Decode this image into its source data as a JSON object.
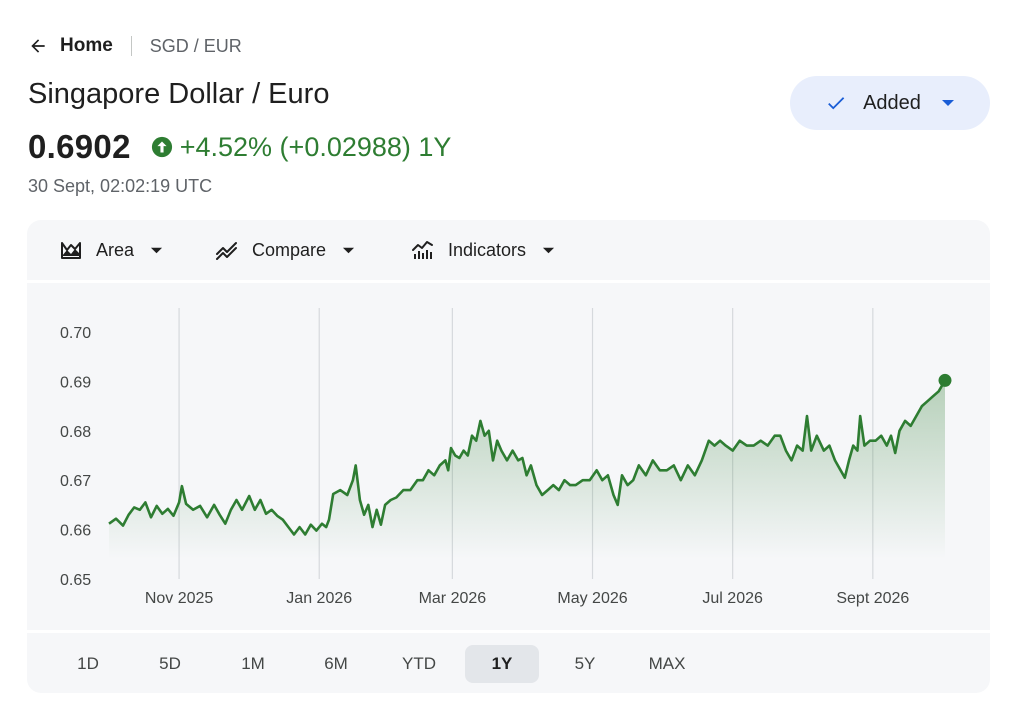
{
  "breadcrumb": {
    "home": "Home",
    "pair": "SGD / EUR"
  },
  "title": "Singapore Dollar / Euro",
  "quote": {
    "price": "0.6902",
    "change": "+4.52% (+0.02988) 1Y",
    "timestamp": "30 Sept, 02:02:19 UTC"
  },
  "watchlist_button": {
    "label": "Added"
  },
  "toolbar": {
    "area": "Area",
    "compare": "Compare",
    "indicators": "Indicators"
  },
  "ranges": [
    {
      "label": "1D",
      "active": false
    },
    {
      "label": "5D",
      "active": false
    },
    {
      "label": "1M",
      "active": false
    },
    {
      "label": "6M",
      "active": false
    },
    {
      "label": "YTD",
      "active": false
    },
    {
      "label": "1Y",
      "active": true
    },
    {
      "label": "5Y",
      "active": false
    },
    {
      "label": "MAX",
      "active": false
    }
  ],
  "colors": {
    "accent": "#2e7d32",
    "button_bg": "#e8eefc",
    "blue": "#1a5dd6"
  },
  "chart_data": {
    "type": "area",
    "ylim": [
      0.65,
      0.7
    ],
    "yticks": [
      "0.70",
      "0.69",
      "0.68",
      "0.67",
      "0.66",
      "0.65"
    ],
    "xticks": [
      {
        "label": "Nov 2025",
        "x": 1.0
      },
      {
        "label": "Jan 2026",
        "x": 3.0
      },
      {
        "label": "Mar 2026",
        "x": 4.9
      },
      {
        "label": "May 2026",
        "x": 6.9
      },
      {
        "label": "Jul 2026",
        "x": 8.9
      },
      {
        "label": "Sept 2026",
        "x": 10.9
      }
    ],
    "x_range": [
      0,
      11.93
    ],
    "series": [
      {
        "points": [
          [
            0.0,
            0.6612
          ],
          [
            0.1,
            0.6622
          ],
          [
            0.2,
            0.6608
          ],
          [
            0.28,
            0.663
          ],
          [
            0.36,
            0.6645
          ],
          [
            0.44,
            0.664
          ],
          [
            0.52,
            0.6655
          ],
          [
            0.6,
            0.6625
          ],
          [
            0.68,
            0.6648
          ],
          [
            0.76,
            0.6632
          ],
          [
            0.84,
            0.6642
          ],
          [
            0.92,
            0.6628
          ],
          [
            1.0,
            0.6655
          ],
          [
            1.04,
            0.6688
          ],
          [
            1.1,
            0.6652
          ],
          [
            1.2,
            0.664
          ],
          [
            1.3,
            0.6648
          ],
          [
            1.4,
            0.6625
          ],
          [
            1.5,
            0.665
          ],
          [
            1.58,
            0.663
          ],
          [
            1.66,
            0.6612
          ],
          [
            1.74,
            0.664
          ],
          [
            1.82,
            0.666
          ],
          [
            1.9,
            0.664
          ],
          [
            2.0,
            0.6668
          ],
          [
            2.08,
            0.664
          ],
          [
            2.16,
            0.666
          ],
          [
            2.24,
            0.6632
          ],
          [
            2.32,
            0.664
          ],
          [
            2.4,
            0.6628
          ],
          [
            2.48,
            0.662
          ],
          [
            2.56,
            0.6605
          ],
          [
            2.64,
            0.659
          ],
          [
            2.72,
            0.6605
          ],
          [
            2.8,
            0.659
          ],
          [
            2.88,
            0.661
          ],
          [
            2.96,
            0.6598
          ],
          [
            3.04,
            0.6612
          ],
          [
            3.1,
            0.6605
          ],
          [
            3.14,
            0.662
          ],
          [
            3.2,
            0.6672
          ],
          [
            3.3,
            0.668
          ],
          [
            3.4,
            0.667
          ],
          [
            3.48,
            0.67
          ],
          [
            3.52,
            0.673
          ],
          [
            3.58,
            0.666
          ],
          [
            3.64,
            0.663
          ],
          [
            3.7,
            0.665
          ],
          [
            3.76,
            0.6605
          ],
          [
            3.82,
            0.664
          ],
          [
            3.88,
            0.661
          ],
          [
            3.94,
            0.665
          ],
          [
            4.02,
            0.666
          ],
          [
            4.1,
            0.6665
          ],
          [
            4.2,
            0.668
          ],
          [
            4.3,
            0.668
          ],
          [
            4.4,
            0.67
          ],
          [
            4.48,
            0.67
          ],
          [
            4.56,
            0.672
          ],
          [
            4.64,
            0.671
          ],
          [
            4.72,
            0.673
          ],
          [
            4.8,
            0.674
          ],
          [
            4.84,
            0.672
          ],
          [
            4.88,
            0.6765
          ],
          [
            4.94,
            0.675
          ],
          [
            5.0,
            0.6745
          ],
          [
            5.06,
            0.676
          ],
          [
            5.12,
            0.675
          ],
          [
            5.18,
            0.679
          ],
          [
            5.24,
            0.678
          ],
          [
            5.3,
            0.682
          ],
          [
            5.36,
            0.679
          ],
          [
            5.42,
            0.68
          ],
          [
            5.48,
            0.674
          ],
          [
            5.54,
            0.678
          ],
          [
            5.6,
            0.676
          ],
          [
            5.68,
            0.674
          ],
          [
            5.76,
            0.676
          ],
          [
            5.84,
            0.674
          ],
          [
            5.9,
            0.6745
          ],
          [
            5.96,
            0.671
          ],
          [
            6.02,
            0.673
          ],
          [
            6.1,
            0.669
          ],
          [
            6.18,
            0.667
          ],
          [
            6.26,
            0.668
          ],
          [
            6.34,
            0.669
          ],
          [
            6.42,
            0.668
          ],
          [
            6.5,
            0.67
          ],
          [
            6.58,
            0.669
          ],
          [
            6.66,
            0.669
          ],
          [
            6.76,
            0.67
          ],
          [
            6.86,
            0.67
          ],
          [
            6.96,
            0.672
          ],
          [
            7.04,
            0.67
          ],
          [
            7.12,
            0.671
          ],
          [
            7.2,
            0.667
          ],
          [
            7.26,
            0.665
          ],
          [
            7.32,
            0.671
          ],
          [
            7.4,
            0.669
          ],
          [
            7.48,
            0.67
          ],
          [
            7.56,
            0.673
          ],
          [
            7.66,
            0.671
          ],
          [
            7.76,
            0.674
          ],
          [
            7.86,
            0.672
          ],
          [
            7.96,
            0.672
          ],
          [
            8.06,
            0.673
          ],
          [
            8.16,
            0.67
          ],
          [
            8.26,
            0.673
          ],
          [
            8.36,
            0.671
          ],
          [
            8.46,
            0.674
          ],
          [
            8.56,
            0.678
          ],
          [
            8.64,
            0.677
          ],
          [
            8.72,
            0.678
          ],
          [
            8.8,
            0.677
          ],
          [
            8.9,
            0.676
          ],
          [
            9.0,
            0.678
          ],
          [
            9.1,
            0.677
          ],
          [
            9.2,
            0.677
          ],
          [
            9.3,
            0.678
          ],
          [
            9.4,
            0.677
          ],
          [
            9.5,
            0.679
          ],
          [
            9.58,
            0.679
          ],
          [
            9.66,
            0.676
          ],
          [
            9.74,
            0.674
          ],
          [
            9.82,
            0.677
          ],
          [
            9.9,
            0.676
          ],
          [
            9.96,
            0.683
          ],
          [
            10.02,
            0.676
          ],
          [
            10.1,
            0.679
          ],
          [
            10.2,
            0.676
          ],
          [
            10.28,
            0.677
          ],
          [
            10.36,
            0.674
          ],
          [
            10.44,
            0.672
          ],
          [
            10.5,
            0.6705
          ],
          [
            10.56,
            0.674
          ],
          [
            10.62,
            0.677
          ],
          [
            10.68,
            0.676
          ],
          [
            10.72,
            0.683
          ],
          [
            10.78,
            0.677
          ],
          [
            10.86,
            0.678
          ],
          [
            10.94,
            0.678
          ],
          [
            11.02,
            0.679
          ],
          [
            11.1,
            0.677
          ],
          [
            11.16,
            0.679
          ],
          [
            11.22,
            0.6755
          ],
          [
            11.28,
            0.68
          ],
          [
            11.36,
            0.682
          ],
          [
            11.44,
            0.681
          ],
          [
            11.52,
            0.683
          ],
          [
            11.6,
            0.685
          ],
          [
            11.68,
            0.686
          ],
          [
            11.76,
            0.687
          ],
          [
            11.84,
            0.688
          ],
          [
            11.93,
            0.6902
          ]
        ]
      }
    ]
  }
}
